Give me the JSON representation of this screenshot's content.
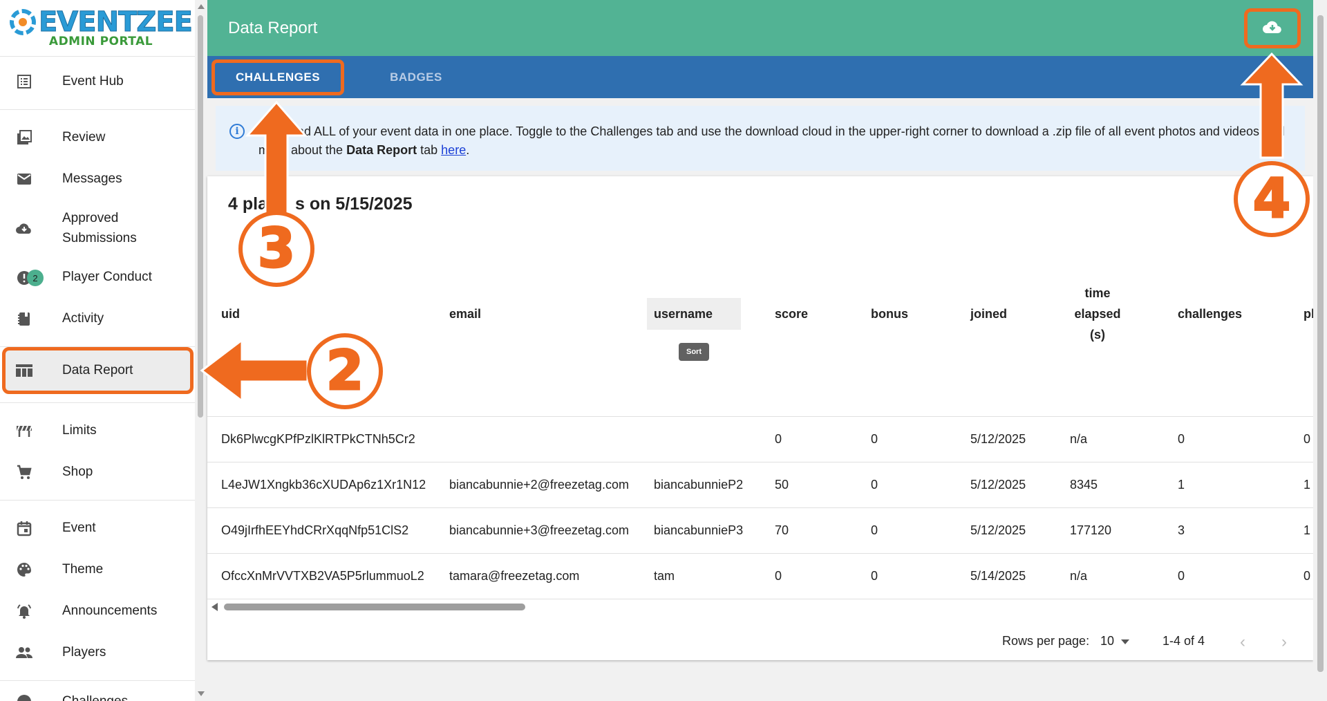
{
  "logo": {
    "title": "EVENTZEE",
    "subtitle": "ADMIN PORTAL"
  },
  "sidebar": {
    "items": [
      {
        "label": "Event Hub",
        "icon": "list-icon"
      },
      {
        "label": "Review",
        "icon": "image-icon"
      },
      {
        "label": "Messages",
        "icon": "mail-icon"
      },
      {
        "label": "Approved Submissions",
        "icon": "cloud-download-icon"
      },
      {
        "label": "Player Conduct",
        "icon": "alert-icon",
        "badge": "2"
      },
      {
        "label": "Activity",
        "icon": "activity-icon"
      },
      {
        "label": "Data Report",
        "icon": "table-icon",
        "active": true
      },
      {
        "label": "Limits",
        "icon": "barrier-icon"
      },
      {
        "label": "Shop",
        "icon": "cart-icon"
      },
      {
        "label": "Event",
        "icon": "calendar-icon"
      },
      {
        "label": "Theme",
        "icon": "palette-icon"
      },
      {
        "label": "Announcements",
        "icon": "bell-icon"
      },
      {
        "label": "Players",
        "icon": "people-icon"
      },
      {
        "label": "Challenges",
        "icon": "check-icon"
      }
    ]
  },
  "header": {
    "title": "Data Report"
  },
  "tabs": [
    {
      "label": "CHALLENGES",
      "active": true
    },
    {
      "label": "BADGES",
      "active": false
    }
  ],
  "info": {
    "line1_a": "ad ALL of your event data in one place. Toggle to the Challenges tab and use the download cloud in the upper-right corner to download a .zip file of all event photos and videos.",
    "line1_b": "d",
    "line2_a": "m",
    "line2_b": "about the",
    "line2_bold": "Data Report",
    "line2_c": "tab",
    "link": "here",
    "line2_end": "."
  },
  "card": {
    "title_left": "4 pla",
    "title_right": "s on 5/15/2025"
  },
  "table": {
    "columns": [
      "uid",
      "email",
      "username",
      "score",
      "bonus",
      "joined",
      "time elapsed (s)",
      "challenges",
      "pl"
    ],
    "time_elapsed_lines": [
      "time",
      "elapsed",
      "(s)"
    ],
    "sort_label": "Sort",
    "rows": [
      [
        "Dk6PlwcgKPfPzlKlRTPkCTNh5Cr2",
        "",
        "",
        "0",
        "0",
        "5/12/2025",
        "n/a",
        "0",
        "0"
      ],
      [
        "L4eJW1Xngkb36cXUDAp6z1Xr1N12",
        "biancabunnie+2@freezetag.com",
        "biancabunnieP2",
        "50",
        "0",
        "5/12/2025",
        "8345",
        "1",
        "1"
      ],
      [
        "O49jIrfhEEYhdCRrXqqNfp51ClS2",
        "biancabunnie+3@freezetag.com",
        "biancabunnieP3",
        "70",
        "0",
        "5/12/2025",
        "177120",
        "3",
        "1"
      ],
      [
        "OfccXnMrVVTXB2VA5P5rlummuoL2",
        "tamara@freezetag.com",
        "tam",
        "0",
        "0",
        "5/14/2025",
        "n/a",
        "0",
        "0"
      ]
    ]
  },
  "pagination": {
    "rows_per_page_label": "Rows per page:",
    "rows_per_page": "10",
    "range": "1-4 of 4"
  },
  "annotations": {
    "n2": "2",
    "n3": "3",
    "n4": "4"
  },
  "colors": {
    "header": "#52b394",
    "tabs": "#2f6fb0",
    "accent": "#ef6a1f",
    "info_bg": "#e7f1fb"
  }
}
